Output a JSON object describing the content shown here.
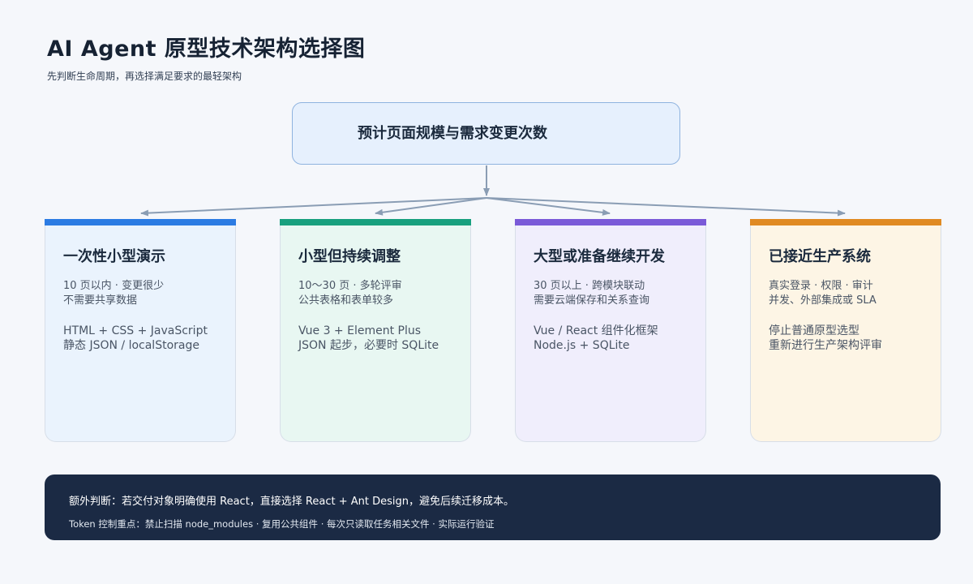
{
  "header": {
    "title": "AI Agent 原型技术架构选择图",
    "subtitle": "先判断生命周期，再选择满足要求的最轻架构"
  },
  "root": {
    "label": "预计页面规模与需求变更次数"
  },
  "colors": {
    "connector": "#8a9db4",
    "footer_bg": "#1b2a44"
  },
  "cards": [
    {
      "title": "一次性小型演示",
      "accent": "#2b7be3",
      "bg": "#eaf3fd",
      "lines": [
        "10 页以内 · 变更很少",
        "不需要共享数据"
      ],
      "stack": [
        "HTML + CSS + JavaScript",
        "静态 JSON / localStorage"
      ]
    },
    {
      "title": "小型但持续调整",
      "accent": "#18a07e",
      "bg": "#e8f7f2",
      "lines": [
        "10～30 页 · 多轮评审",
        "公共表格和表单较多"
      ],
      "stack": [
        "Vue 3 + Element Plus",
        "JSON 起步，必要时 SQLite"
      ]
    },
    {
      "title": "大型或准备继续开发",
      "accent": "#7a5ad8",
      "bg": "#f0eefc",
      "lines": [
        "30 页以上 · 跨模块联动",
        "需要云端保存和关系查询"
      ],
      "stack": [
        "Vue / React 组件化框架",
        "Node.js + SQLite"
      ]
    },
    {
      "title": "已接近生产系统",
      "accent": "#e08a22",
      "bg": "#fdf5e5",
      "lines": [
        "真实登录 · 权限 · 审计",
        "并发、外部集成或 SLA"
      ],
      "stack": [
        "停止普通原型选型",
        "重新进行生产架构评审"
      ]
    }
  ],
  "footer": {
    "line1": "额外判断：若交付对象明确使用 React，直接选择 React + Ant Design，避免后续迁移成本。",
    "line2": "Token 控制重点：禁止扫描 node_modules · 复用公共组件 · 每次只读取任务相关文件 · 实际运行验证"
  }
}
